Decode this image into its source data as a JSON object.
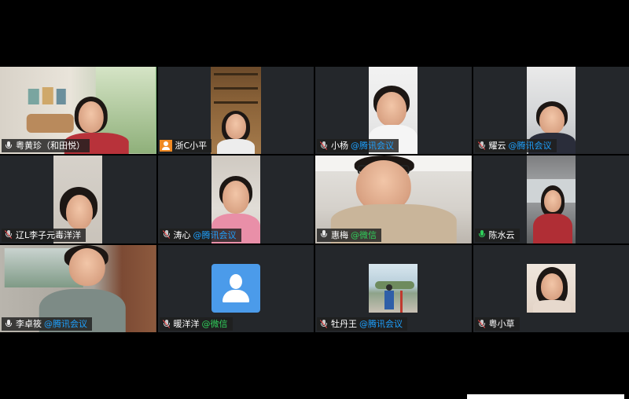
{
  "participants": [
    {
      "name": "粤黄珍（和田悦）",
      "via": "",
      "mic": "unmuted"
    },
    {
      "name": "浙C小平",
      "via": "",
      "mic": "person"
    },
    {
      "name": "小杨",
      "via": "@腾讯会议",
      "mic": "off"
    },
    {
      "name": "耀云",
      "via": "@腾讯会议",
      "mic": "off"
    },
    {
      "name": "辽L李子元毒洋洋",
      "via": "",
      "mic": "off"
    },
    {
      "name": "涛心",
      "via": "@腾讯会议",
      "mic": "off"
    },
    {
      "name": "惠梅",
      "via": "@微信",
      "mic": "unmuted"
    },
    {
      "name": "陈水云",
      "via": "",
      "mic": "on"
    },
    {
      "name": "李卓筱",
      "via": "@腾讯会议",
      "mic": "unmuted"
    },
    {
      "name": "暖洋洋",
      "via": "@微信",
      "mic": "off"
    },
    {
      "name": "牡丹王",
      "via": "@腾讯会议",
      "mic": "off"
    },
    {
      "name": "粤小草",
      "via": "",
      "mic": "off"
    }
  ],
  "colors": {
    "active_border": "#22c55e",
    "tencent_tag": "#1ea1ff",
    "wechat_tag": "#2fcf5a",
    "avatar_placeholder": "#4b9bea"
  }
}
